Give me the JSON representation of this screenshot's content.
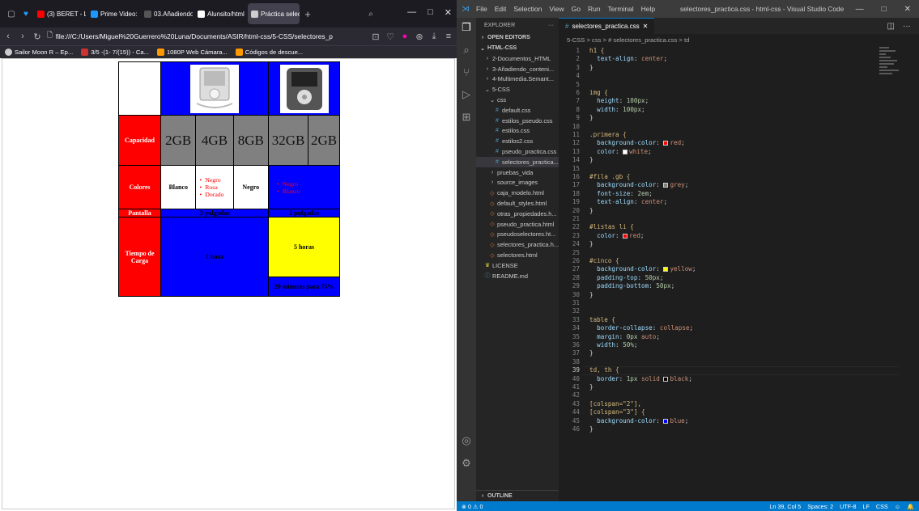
{
  "browser": {
    "tabs": [
      {
        "label": "(3) BERET - LI",
        "favicon_color": "#ff0000"
      },
      {
        "label": "Prime Video:",
        "favicon_color": "#1a98ff"
      },
      {
        "label": "03.Añadiendo",
        "favicon_color": "#555555"
      },
      {
        "label": "Alunsito/html",
        "favicon_color": "#ffffff"
      },
      {
        "label": "Práctica selec",
        "favicon_color": "#cccccc",
        "active": true
      }
    ],
    "url": "file:///C:/Users/Miguel%20Guerrero%20Luna/Documents/ASIR/html-css/5-CSS/selectores_p",
    "bookmarks": [
      "Sailor Moon R – Ep...",
      "3/5 -(1- 7/(15)) - Ca...",
      "1080P Web Cámara...",
      "Códigos de descue..."
    ]
  },
  "table": {
    "capacidad": "Capacidad",
    "cap_values": [
      "2GB",
      "4GB",
      "8GB",
      "32GB",
      "2GB"
    ],
    "colores": "Colores",
    "blanco": "Blanco",
    "negro": "Negro",
    "list1": [
      "Negro",
      "Rosa",
      "Dorado"
    ],
    "list2": [
      "Negro",
      "Blanco"
    ],
    "pantalla": "Pantalla",
    "pantalla1": "3 pulgadas",
    "pantalla2": "2 pulgadas",
    "tiempo": "Tiempo de Carga",
    "una_hora": "1 hora",
    "cinco_horas": "5 horas",
    "veinte_min": "20 minutos para 75%"
  },
  "vscode": {
    "title": "selectores_practica.css - html-css - Visual Studio Code",
    "menu": [
      "File",
      "Edit",
      "Selection",
      "View",
      "Go",
      "Run",
      "Terminal",
      "Help"
    ],
    "explorer_label": "EXPLORER",
    "open_editors": "OPEN EDITORS",
    "project": "HTML-CSS",
    "tree": [
      {
        "label": "2-Documentos_HTML",
        "indent": 1,
        "icon": ">"
      },
      {
        "label": "3-Añadiendo_conteni...",
        "indent": 1,
        "icon": ">"
      },
      {
        "label": "4-Multimedia.Semant...",
        "indent": 1,
        "icon": ">"
      },
      {
        "label": "5-CSS",
        "indent": 1,
        "icon": "v"
      },
      {
        "label": "css",
        "indent": 2,
        "icon": "v"
      },
      {
        "label": "default.css",
        "indent": 3,
        "icon": "#"
      },
      {
        "label": "estilos_pseudo.css",
        "indent": 3,
        "icon": "#"
      },
      {
        "label": "estilos.css",
        "indent": 3,
        "icon": "#"
      },
      {
        "label": "estilos2.css",
        "indent": 3,
        "icon": "#"
      },
      {
        "label": "pseudo_practica.css",
        "indent": 3,
        "icon": "#"
      },
      {
        "label": "selectores_practica...",
        "indent": 3,
        "icon": "#",
        "selected": true
      },
      {
        "label": "pruebas_vida",
        "indent": 2,
        "icon": ">"
      },
      {
        "label": "source_images",
        "indent": 2,
        "icon": ">"
      },
      {
        "label": "caja_modelo.html",
        "indent": 2,
        "icon": "<>"
      },
      {
        "label": "default_styles.html",
        "indent": 2,
        "icon": "<>"
      },
      {
        "label": "otras_propiedades.h...",
        "indent": 2,
        "icon": "<>"
      },
      {
        "label": "pseudo_practica.html",
        "indent": 2,
        "icon": "<>"
      },
      {
        "label": "pseudoselectores.ht...",
        "indent": 2,
        "icon": "<>"
      },
      {
        "label": "selectores_practica.h...",
        "indent": 2,
        "icon": "<>"
      },
      {
        "label": "selectores.html",
        "indent": 2,
        "icon": "<>"
      },
      {
        "label": "LICENSE",
        "indent": 1,
        "icon": "!"
      },
      {
        "label": "README.md",
        "indent": 1,
        "icon": "i"
      }
    ],
    "outline": "OUTLINE",
    "tab": "selectores_practica.css",
    "breadcrumb": "5-CSS > css > # selectores_practica.css > td",
    "code": [
      [
        [
          "sel",
          "h1 {"
        ]
      ],
      [
        [
          "prop",
          "  text-align"
        ],
        [
          "p",
          ": "
        ],
        [
          "val",
          "center"
        ],
        [
          "p",
          ";"
        ]
      ],
      [
        [
          "p",
          "}"
        ]
      ],
      [],
      [],
      [
        [
          "sel",
          "img {"
        ]
      ],
      [
        [
          "prop",
          "  height"
        ],
        [
          "p",
          ": "
        ],
        [
          "num",
          "100px"
        ],
        [
          "p",
          ";"
        ]
      ],
      [
        [
          "prop",
          "  width"
        ],
        [
          "p",
          ": "
        ],
        [
          "num",
          "100px"
        ],
        [
          "p",
          ";"
        ]
      ],
      [
        [
          "p",
          "}"
        ]
      ],
      [],
      [
        [
          "sel",
          ".primera {"
        ]
      ],
      [
        [
          "prop",
          "  background-color"
        ],
        [
          "p",
          ": "
        ],
        [
          "sw",
          "#ff0000"
        ],
        [
          "val",
          "red"
        ],
        [
          "p",
          ";"
        ]
      ],
      [
        [
          "prop",
          "  color"
        ],
        [
          "p",
          ": "
        ],
        [
          "sw",
          "#ffffff"
        ],
        [
          "val",
          "white"
        ],
        [
          "p",
          ";"
        ]
      ],
      [
        [
          "p",
          "}"
        ]
      ],
      [],
      [
        [
          "sel",
          "#fila .gb {"
        ]
      ],
      [
        [
          "prop",
          "  background-color"
        ],
        [
          "p",
          ": "
        ],
        [
          "sw",
          "#808080"
        ],
        [
          "val",
          "grey"
        ],
        [
          "p",
          ";"
        ]
      ],
      [
        [
          "prop",
          "  font-size"
        ],
        [
          "p",
          ": "
        ],
        [
          "num",
          "2em"
        ],
        [
          "p",
          ";"
        ]
      ],
      [
        [
          "prop",
          "  text-align"
        ],
        [
          "p",
          ": "
        ],
        [
          "val",
          "center"
        ],
        [
          "p",
          ";"
        ]
      ],
      [
        [
          "p",
          "}"
        ]
      ],
      [],
      [
        [
          "sel",
          "#listas li {"
        ]
      ],
      [
        [
          "prop",
          "  color"
        ],
        [
          "p",
          ": "
        ],
        [
          "sw",
          "#ff0000"
        ],
        [
          "val",
          "red"
        ],
        [
          "p",
          ";"
        ]
      ],
      [
        [
          "p",
          "}"
        ]
      ],
      [],
      [
        [
          "sel",
          "#cinco {"
        ]
      ],
      [
        [
          "prop",
          "  background-color"
        ],
        [
          "p",
          ": "
        ],
        [
          "sw",
          "#ffff00"
        ],
        [
          "val",
          "yellow"
        ],
        [
          "p",
          ";"
        ]
      ],
      [
        [
          "prop",
          "  padding-top"
        ],
        [
          "p",
          ": "
        ],
        [
          "num",
          "50px"
        ],
        [
          "p",
          ";"
        ]
      ],
      [
        [
          "prop",
          "  padding-bottom"
        ],
        [
          "p",
          ": "
        ],
        [
          "num",
          "50px"
        ],
        [
          "p",
          ";"
        ]
      ],
      [
        [
          "p",
          "}"
        ]
      ],
      [],
      [],
      [
        [
          "sel",
          "table {"
        ]
      ],
      [
        [
          "prop",
          "  border-collapse"
        ],
        [
          "p",
          ": "
        ],
        [
          "val",
          "collapse"
        ],
        [
          "p",
          ";"
        ]
      ],
      [
        [
          "prop",
          "  margin"
        ],
        [
          "p",
          ": "
        ],
        [
          "num",
          "0px"
        ],
        [
          "val",
          " auto"
        ],
        [
          "p",
          ";"
        ]
      ],
      [
        [
          "prop",
          "  width"
        ],
        [
          "p",
          ": "
        ],
        [
          "num",
          "50%"
        ],
        [
          "p",
          ";"
        ]
      ],
      [
        [
          "p",
          "}"
        ]
      ],
      [],
      [
        [
          "sel",
          "td, th {"
        ]
      ],
      [
        [
          "prop",
          "  border"
        ],
        [
          "p",
          ": "
        ],
        [
          "num",
          "1px"
        ],
        [
          "val",
          " solid "
        ],
        [
          "sw",
          "#000000"
        ],
        [
          "val",
          "black"
        ],
        [
          "p",
          ";"
        ]
      ],
      [
        [
          "p",
          "}"
        ]
      ],
      [],
      [
        [
          "sel",
          "[colspan=\"2\"],"
        ]
      ],
      [
        [
          "sel",
          "[colspan=\"3\"] {"
        ]
      ],
      [
        [
          "prop",
          "  background-color"
        ],
        [
          "p",
          ": "
        ],
        [
          "sw",
          "#0000ff"
        ],
        [
          "val",
          "blue"
        ],
        [
          "p",
          ";"
        ]
      ],
      [
        [
          "p",
          "}"
        ]
      ]
    ],
    "current_line": 39,
    "status_left": "⊗ 0 ⚠ 0",
    "status_right": [
      "Ln 39, Col 5",
      "Spaces: 2",
      "UTF-8",
      "LF",
      "CSS"
    ]
  }
}
